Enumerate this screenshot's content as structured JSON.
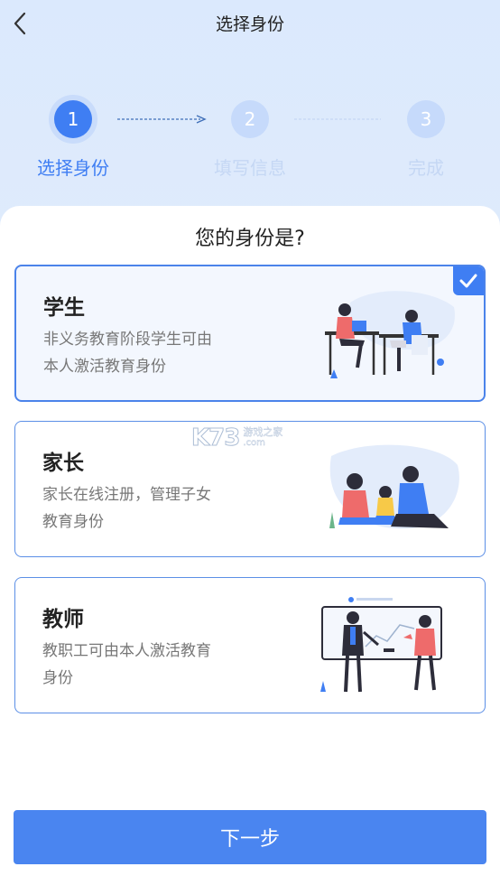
{
  "header": {
    "title": "选择身份"
  },
  "stepper": {
    "steps": [
      {
        "number": "1",
        "label": "选择身份"
      },
      {
        "number": "2",
        "label": "填写信息"
      },
      {
        "number": "3",
        "label": "完成"
      }
    ],
    "current_step": 1
  },
  "question": "您的身份是?",
  "roles": [
    {
      "title": "学生",
      "desc_line1": "非义务教育阶段学生可由",
      "desc_line2": "本人激活教育身份",
      "selected": true
    },
    {
      "title": "家长",
      "desc_line1": "家长在线注册，管理子女",
      "desc_line2": "教育身份",
      "selected": false
    },
    {
      "title": "教师",
      "desc_line1": "教职工可由本人激活教育",
      "desc_line2": "身份",
      "selected": false
    }
  ],
  "watermark": {
    "logo": "K73",
    "cn": "游戏之家",
    "com": ".com"
  },
  "next_button": {
    "label": "下一步"
  },
  "colors": {
    "accent": "#3f7ef3",
    "step_inactive": "#c6dafb",
    "header_bg": "#dbe9fd"
  }
}
